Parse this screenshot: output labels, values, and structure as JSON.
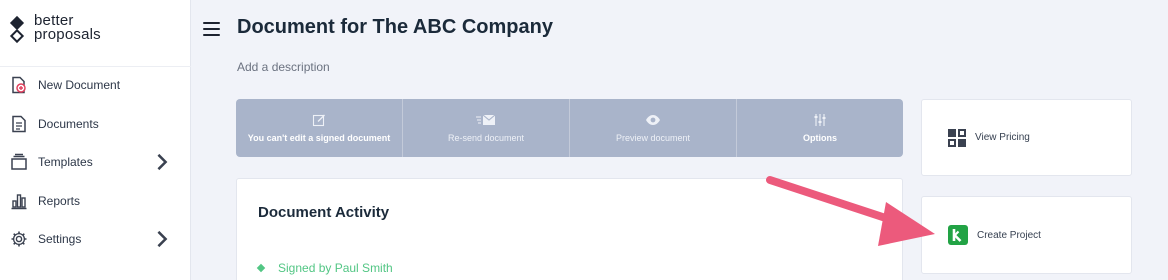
{
  "brand": {
    "line1": "better",
    "line2": "proposals"
  },
  "sidebar": {
    "items": [
      {
        "label": "New Document",
        "icon": "new-document-icon",
        "has_chevron": false
      },
      {
        "label": "Documents",
        "icon": "documents-icon",
        "has_chevron": false
      },
      {
        "label": "Templates",
        "icon": "templates-icon",
        "has_chevron": true
      },
      {
        "label": "Reports",
        "icon": "reports-icon",
        "has_chevron": false
      },
      {
        "label": "Settings",
        "icon": "settings-icon",
        "has_chevron": true
      }
    ]
  },
  "header": {
    "title": "Document for The ABC Company",
    "description_placeholder": "Add a description"
  },
  "toolbar": {
    "items": [
      {
        "label": "You can't edit a signed document",
        "icon": "edit-icon",
        "bold": true
      },
      {
        "label": "Re-send document",
        "icon": "email-icon",
        "bold": false
      },
      {
        "label": "Preview document",
        "icon": "eye-icon",
        "bold": false
      },
      {
        "label": "Options",
        "icon": "sliders-icon",
        "bold": true
      }
    ]
  },
  "activity": {
    "title": "Document Activity",
    "entries": [
      {
        "text": "Signed by Paul Smith"
      }
    ]
  },
  "cards": {
    "pricing": {
      "label": "View Pricing",
      "icon": "grid-icon"
    },
    "project": {
      "label": "Create Project",
      "icon": "k-logo-icon"
    }
  },
  "colors": {
    "toolbar_bg": "#a9b4ca",
    "accent_green": "#52c684",
    "annotation_arrow": "#ec5a7c",
    "page_bg": "#f1f3f9"
  }
}
